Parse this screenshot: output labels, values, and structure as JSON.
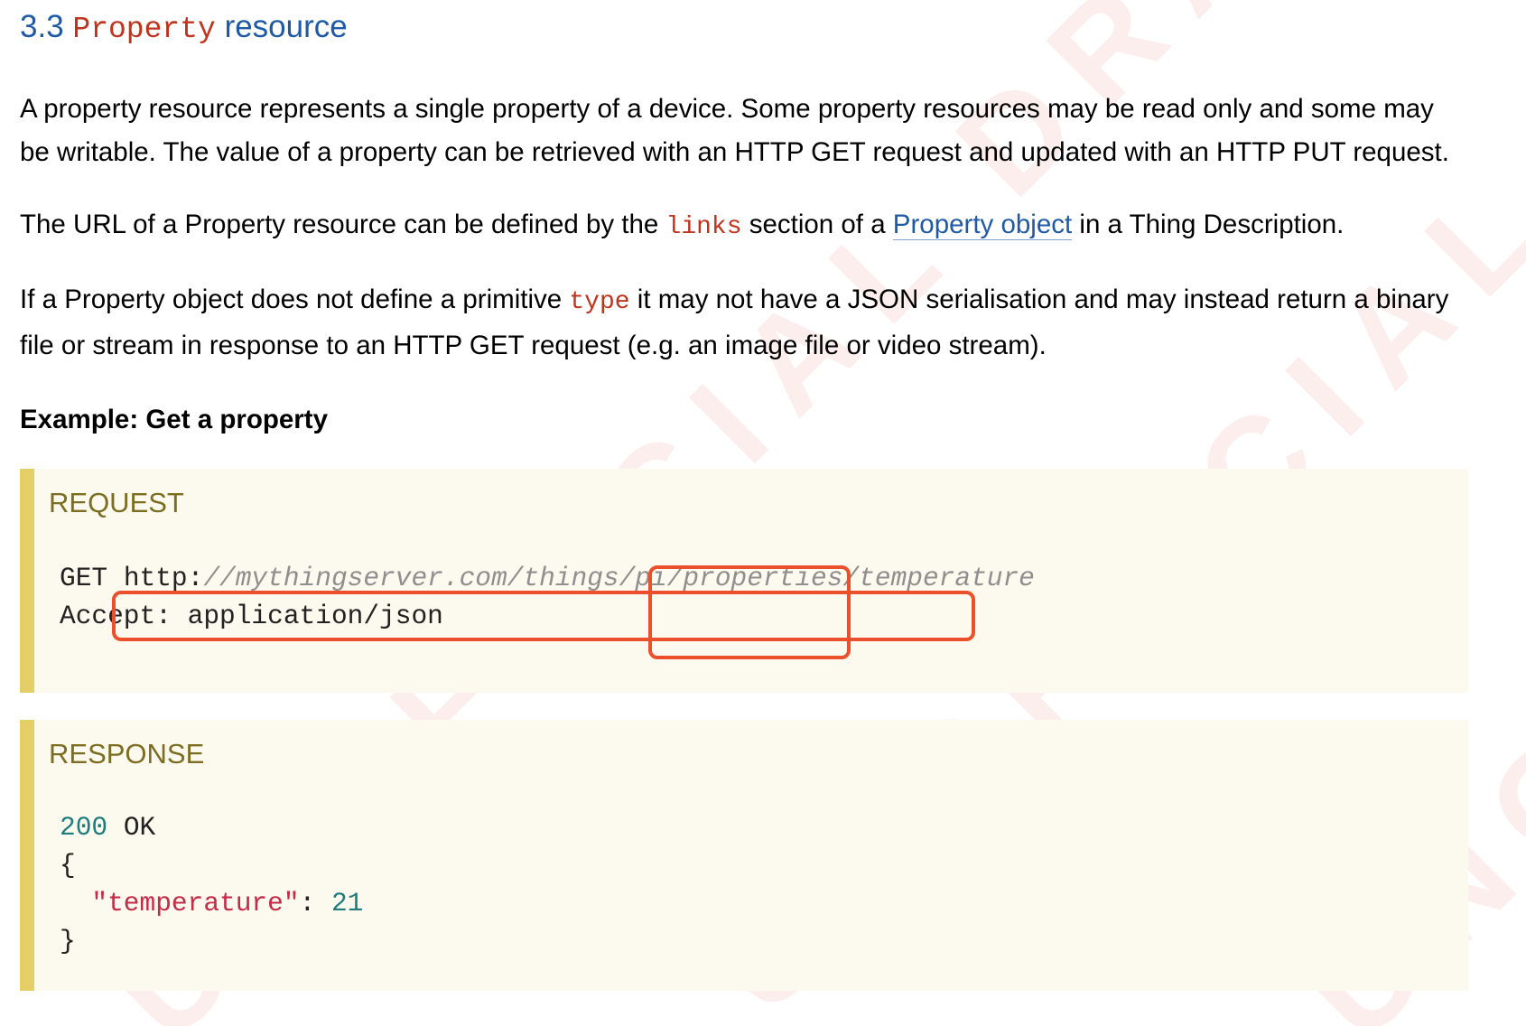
{
  "section": {
    "number": "3.3",
    "title_code": "Property",
    "title_rest": "resource"
  },
  "paragraphs": {
    "p1": "A property resource represents a single property of a device. Some property resources may be read only and some may be writable. The value of a property can be retrieved with an HTTP GET request and updated with an HTTP PUT request.",
    "p2_before": "The URL of a Property resource can be defined by the ",
    "p2_code": "links",
    "p2_middle": " section of a ",
    "p2_link": "Property object",
    "p2_after": " in a Thing Description.",
    "p3_before": "If a Property object does not define a primitive ",
    "p3_code": "type",
    "p3_after": " it may not have a JSON serialisation and may instead return a binary file or stream in response to an HTTP GET request (e.g. an image file or video stream)."
  },
  "example": {
    "heading": "Example: Get a property",
    "request": {
      "label": "REQUEST",
      "method": "GET",
      "url_scheme": "http:",
      "url_path": "//mythingserver.com/things/pi/properties/temperature",
      "header_line": "Accept: application/json"
    },
    "response": {
      "label": "RESPONSE",
      "status_code": "200",
      "status_text": "OK",
      "open_brace": "{",
      "key": "\"temperature\"",
      "colon": ": ",
      "value": "21",
      "close_brace": "}"
    }
  },
  "watermark": {
    "text": "UNOFFICIAL DRAFT"
  },
  "colors": {
    "heading_blue": "#1f5aa6",
    "code_red": "#c0341d",
    "highlight": "#ec4f2b",
    "example_bg": "#fcfaee",
    "example_bar": "#e3cf66",
    "label_olive": "#7c6d21"
  }
}
